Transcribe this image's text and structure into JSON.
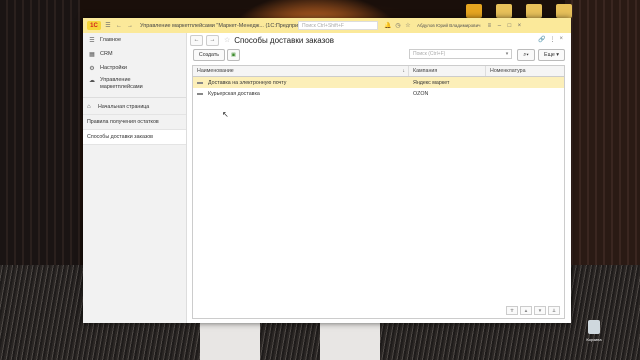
{
  "app": {
    "title": "Управление маркетплейсами \"Маркет-Менедж...   (1С:Предприятие)",
    "logo_text": "1С",
    "search_placeholder": "Поиск Ctrl+Shift+F",
    "user": "Абдулов Юрий Владимирович"
  },
  "sidebar": {
    "sections": [
      {
        "label": "Главное",
        "icon": "menu-icon"
      },
      {
        "label": "CRM",
        "icon": "calendar-icon"
      },
      {
        "label": "Настройки",
        "icon": "gear-icon"
      },
      {
        "label": "Управление маркетплейсами",
        "icon": "cloud-icon"
      }
    ],
    "nav": [
      {
        "label": "Начальная страница",
        "icon": "home-icon"
      },
      {
        "label": "Правила получения остатков"
      },
      {
        "label": "Способы доставки заказов"
      }
    ]
  },
  "form": {
    "title": "Способы доставки заказов",
    "create_label": "Создать",
    "search_placeholder": "Поиск (Ctrl+F)",
    "more_label": "Еще"
  },
  "table": {
    "columns": [
      "Наименование",
      "Кампания",
      "Номенклатура"
    ],
    "rows": [
      {
        "name": "Доставка на электронную почту",
        "campaign": "Яндекс маркет",
        "nomenclature": ""
      },
      {
        "name": "Курьерская доставка",
        "campaign": "OZON",
        "nomenclature": ""
      }
    ]
  },
  "desktop": {
    "recycle_bin_label": "Корзина"
  }
}
